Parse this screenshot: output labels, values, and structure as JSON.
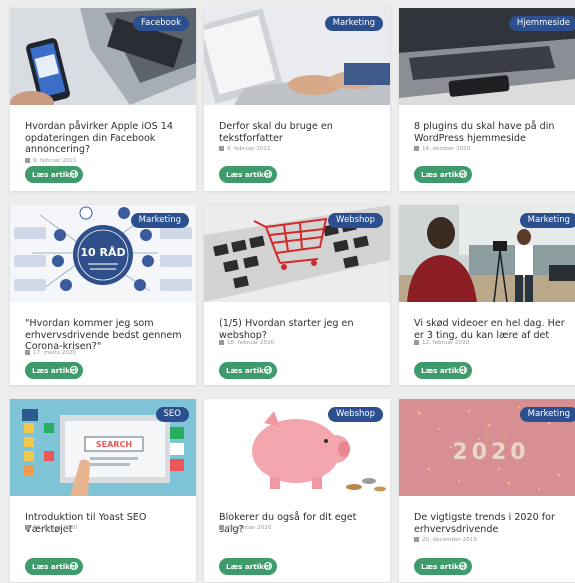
{
  "articles": [
    {
      "category": "Facebook",
      "title": "Hvordan påvirker Apple iOS 14 opdateringen din Facebook annoncering?",
      "date": "9. februar 2021",
      "cta": "Læs artikel",
      "image": "phone-laptop-facebook"
    },
    {
      "category": "Marketing",
      "title": "Derfor skal du bruge en tekstforfatter",
      "date": "8. februar 2021",
      "cta": "Læs artikel",
      "image": "hands-typing-laptop"
    },
    {
      "category": "Hjemmeside",
      "title": "8 plugins du skal have på din WordPress hjemmeside",
      "date": "14. oktober 2020",
      "cta": "Læs artikel",
      "image": "laptop-phone-desk"
    },
    {
      "category": "Marketing",
      "title": "\"Hvordan kommer jeg som erhvervsdrivende bedst gennem Corona-krisen?\"",
      "date": "17. marts 2020",
      "cta": "Læs artikel",
      "image": "10-raad-infographic",
      "image_text": "10 RÅD"
    },
    {
      "category": "Webshop",
      "title": "(1/5) Hvordan starter jeg en webshop?",
      "date": "18. februar 2020",
      "cta": "Læs artikel",
      "image": "shopping-cart-keyboard"
    },
    {
      "category": "Marketing",
      "title": "Vi skød videoer en hel dag. Her er 3 ting, du kan lære af det",
      "date": "12. februar 2020",
      "cta": "Læs artikel",
      "image": "video-shoot"
    },
    {
      "category": "SEO",
      "title": "Introduktion til Yoast SEO Værktøjet",
      "date": "24. januar 2020",
      "cta": "Læs artikel",
      "image": "seo-illustration",
      "image_text": "SEARCH"
    },
    {
      "category": "Webshop",
      "title": "Blokerer du også for dit eget salg?",
      "date": "22. januar 2020",
      "cta": "Læs artikel",
      "image": "piggy-bank"
    },
    {
      "category": "Marketing",
      "title": "De vigtigste trends i 2020 for erhvervsdrivende",
      "date": "20. december 2019",
      "cta": "Læs artikel",
      "image": "2020-glitter",
      "image_text": "2020"
    }
  ],
  "colors": {
    "badge": "#2c4f8f",
    "button": "#3f9b6b",
    "background": "#ededed"
  }
}
